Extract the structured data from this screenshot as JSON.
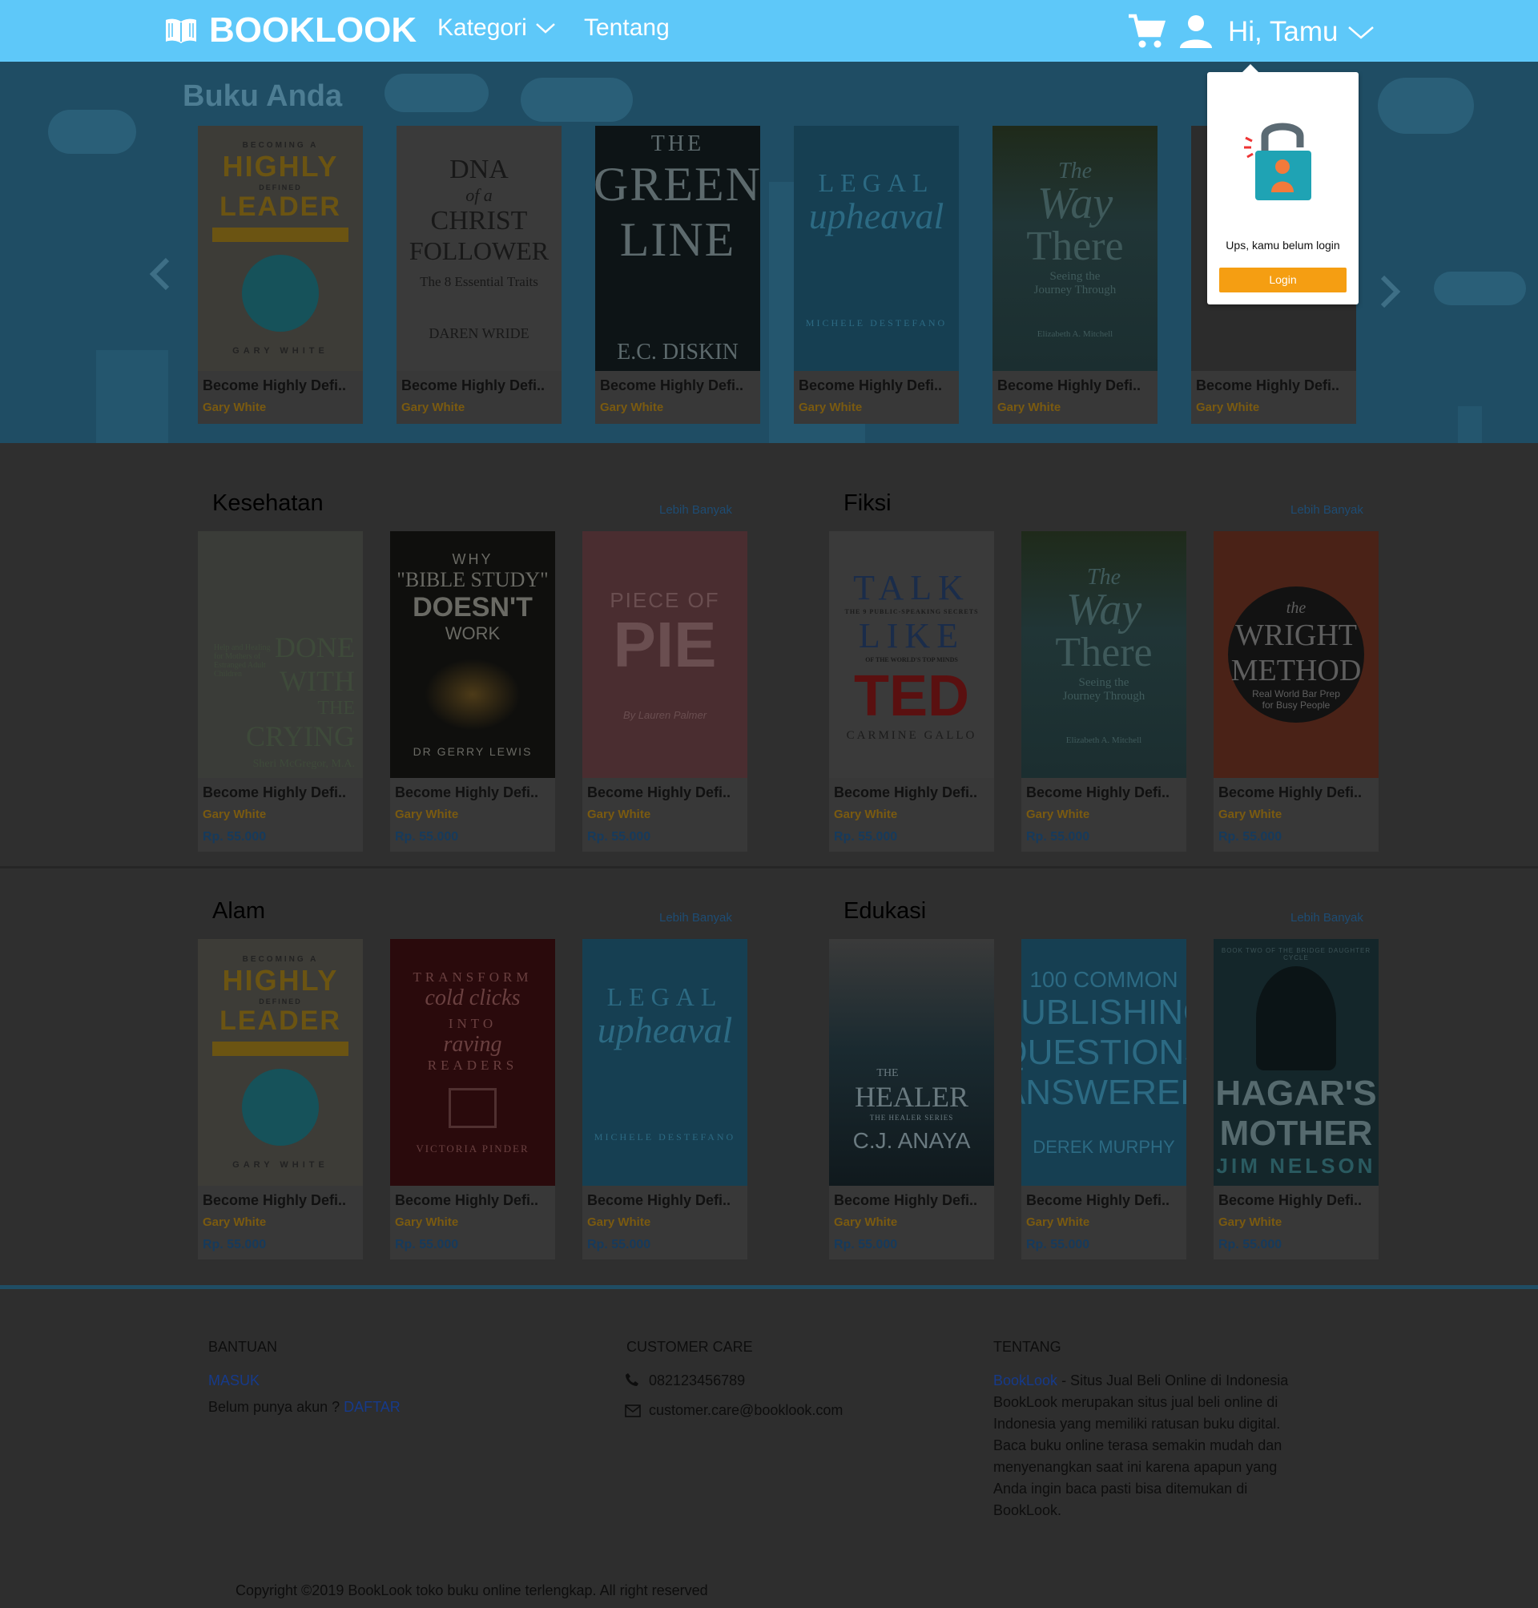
{
  "header": {
    "brand": "BOOKLOOK",
    "nav": [
      {
        "label": "Kategori"
      },
      {
        "label": "Tentang"
      }
    ],
    "greeting": "Hi, Tamu",
    "color": "#5ec8f9"
  },
  "popup": {
    "message": "Ups, kamu belum login",
    "button": "Login",
    "button_color": "#f59e12"
  },
  "hero": {
    "title": "Buku Anda",
    "books": [
      {
        "title": "Become Highly Defi..",
        "author": "Gary White",
        "cover": "leader"
      },
      {
        "title": "Become Highly Defi..",
        "author": "Gary White",
        "cover": "dna"
      },
      {
        "title": "Become Highly Defi..",
        "author": "Gary White",
        "cover": "green"
      },
      {
        "title": "Become Highly Defi..",
        "author": "Gary White",
        "cover": "legal"
      },
      {
        "title": "Become Highly Defi..",
        "author": "Gary White",
        "cover": "way"
      },
      {
        "title": "Become Highly Defi..",
        "author": "Gary White",
        "cover": "ruin"
      }
    ]
  },
  "sections": [
    {
      "title": "Kesehatan",
      "more": "Lebih Banyak",
      "books": [
        {
          "title": "Become Highly Defi..",
          "author": "Gary White",
          "price": "Rp. 55.000",
          "cover": "crying"
        },
        {
          "title": "Become Highly Defi..",
          "author": "Gary White",
          "price": "Rp. 55.000",
          "cover": "bible"
        },
        {
          "title": "Become Highly Defi..",
          "author": "Gary White",
          "price": "Rp. 55.000",
          "cover": "pie"
        }
      ]
    },
    {
      "title": "Fiksi",
      "more": "Lebih Banyak",
      "books": [
        {
          "title": "Become Highly Defi..",
          "author": "Gary White",
          "price": "Rp. 55.000",
          "cover": "ted"
        },
        {
          "title": "Become Highly Defi..",
          "author": "Gary White",
          "price": "Rp. 55.000",
          "cover": "way"
        },
        {
          "title": "Become Highly Defi..",
          "author": "Gary White",
          "price": "Rp. 55.000",
          "cover": "wright"
        }
      ]
    },
    {
      "title": "Alam",
      "more": "Lebih Banyak",
      "books": [
        {
          "title": "Become Highly Defi..",
          "author": "Gary White",
          "price": "Rp. 55.000",
          "cover": "leader"
        },
        {
          "title": "Become Highly Defi..",
          "author": "Gary White",
          "price": "Rp. 55.000",
          "cover": "transform"
        },
        {
          "title": "Become Highly Defi..",
          "author": "Gary White",
          "price": "Rp. 55.000",
          "cover": "legal"
        }
      ]
    },
    {
      "title": "Edukasi",
      "more": "Lebih Banyak",
      "books": [
        {
          "title": "Become Highly Defi..",
          "author": "Gary White",
          "price": "Rp. 55.000",
          "cover": "healer"
        },
        {
          "title": "Become Highly Defi..",
          "author": "Gary White",
          "price": "Rp. 55.000",
          "cover": "publishing"
        },
        {
          "title": "Become Highly Defi..",
          "author": "Gary White",
          "price": "Rp. 55.000",
          "cover": "hagar"
        }
      ]
    }
  ],
  "covers": {
    "leader": {
      "l1": "BECOMING A",
      "l2": "HIGHLY",
      "l3": "DEFINED",
      "l4": "LEADER",
      "l5": "GARY WHITE"
    },
    "dna": {
      "l1": "DNA",
      "l2": "of a",
      "l3": "CHRIST",
      "l4": "FOLLOWER",
      "l5": "The 8 Essential Traits",
      "l6": "DAREN WRIDE"
    },
    "green": {
      "l1": "THE",
      "l2": "GREEN",
      "l3": "LINE",
      "l4": "E.C. DISKIN"
    },
    "legal": {
      "l1": "LEGAL",
      "l2": "upheaval",
      "l3": "MICHELE DESTEFANO"
    },
    "way": {
      "l1": "The",
      "l2": "Way",
      "l3": "There",
      "l4": "Seeing the",
      "l5": "Journey Through",
      "l6": "Elizabeth A. Mitchell"
    },
    "ruin": {},
    "crying": {
      "l1": "Help and Healing for Mothers of Estranged Adult Children",
      "l2": "DONE",
      "l3": "WITH",
      "l4": "THE",
      "l5": "CRYING",
      "l6": "Sheri McGregor, M.A."
    },
    "bible": {
      "l1": "WHY",
      "l2": "\"BIBLE STUDY\"",
      "l3": "DOESN'T",
      "l4": "WORK",
      "l5": "DR GERRY LEWIS"
    },
    "pie": {
      "l1": "PIECE OF",
      "l2": "PIE",
      "l3": "By Lauren Palmer"
    },
    "ted": {
      "l1": "TALK",
      "l2": "THE 9 PUBLIC-SPEAKING SECRETS",
      "l3": "LIKE",
      "l4": "OF THE WORLD'S TOP MINDS",
      "l5": "TED",
      "l6": "CARMINE GALLO"
    },
    "wright": {
      "l1": "the",
      "l2": "WRIGHT",
      "l3": "METHOD",
      "l4": "Real World Bar Prep for Busy People"
    },
    "transform": {
      "l1": "TRANSFORM",
      "l2": "cold clicks",
      "l3": "INTO",
      "l4": "raving",
      "l5": "READERS",
      "l6": "VICTORIA PINDER"
    },
    "healer": {
      "l1": "THE",
      "l2": "HEALER",
      "l3": "THE HEALER SERIES",
      "l4": "C.J. ANAYA"
    },
    "publishing": {
      "l1": "100 COMMON",
      "l2": "PUBLISHING",
      "l3": "QUESTIONS",
      "l4": "ANSWERED",
      "l5": "DEREK MURPHY"
    },
    "hagar": {
      "l1": "BOOK TWO OF THE BRIDGE DAUGHTER CYCLE",
      "l2": "HAGAR'S",
      "l3": "MOTHER",
      "l4": "JIM NELSON"
    }
  },
  "footer": {
    "bantuan": {
      "heading": "BANTUAN",
      "login": "MASUK",
      "no_account": "Belum punya akun ?",
      "register": "DAFTAR"
    },
    "care": {
      "heading": "CUSTOMER CARE",
      "phone": "082123456789",
      "email": "customer.care@booklook.com"
    },
    "about": {
      "heading": "TENTANG",
      "brand": "BookLook",
      "tagline": " - Situs Jual Beli Online di Indonesia",
      "text": "BookLook merupakan situs jual beli online di Indonesia yang memiliki ratusan buku digital. Baca buku online terasa semakin mudah dan menyenangkan saat ini karena apapun yang Anda ingin baca pasti bisa ditemukan di BookLook."
    },
    "copyright": "Copyright ©2019 BookLook toko buku online terlengkap. All right reserved"
  }
}
